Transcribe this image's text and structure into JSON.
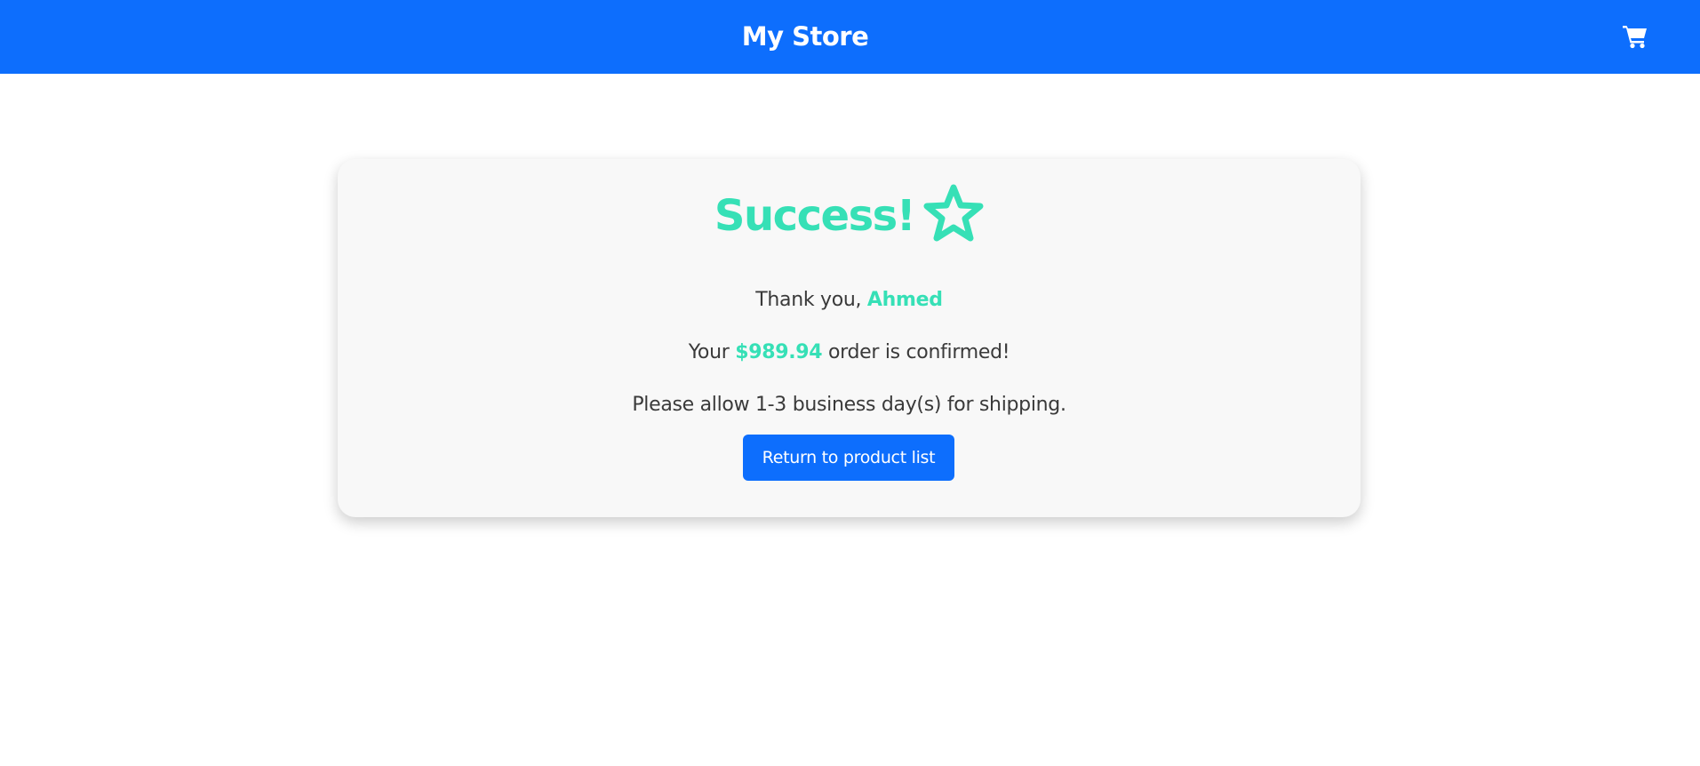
{
  "header": {
    "brand": "My Store",
    "cart_icon": "shopping-cart-icon"
  },
  "confirmation": {
    "title": "Success!",
    "title_icon": "star-outline-icon",
    "thanks_prefix": "Thank you, ",
    "customer_name": "Ahmed",
    "order_prefix": "Your ",
    "order_total": "$989.94",
    "order_suffix": " order is confirmed!",
    "shipping_note": "Please allow 1-3 business day(s) for shipping.",
    "return_button_label": "Return to product list"
  },
  "colors": {
    "navbar": "#0d6efd",
    "accent": "#36e0b6",
    "button": "#0d6efd",
    "card_bg": "#f8f8f8",
    "text": "#3a3a3a"
  }
}
